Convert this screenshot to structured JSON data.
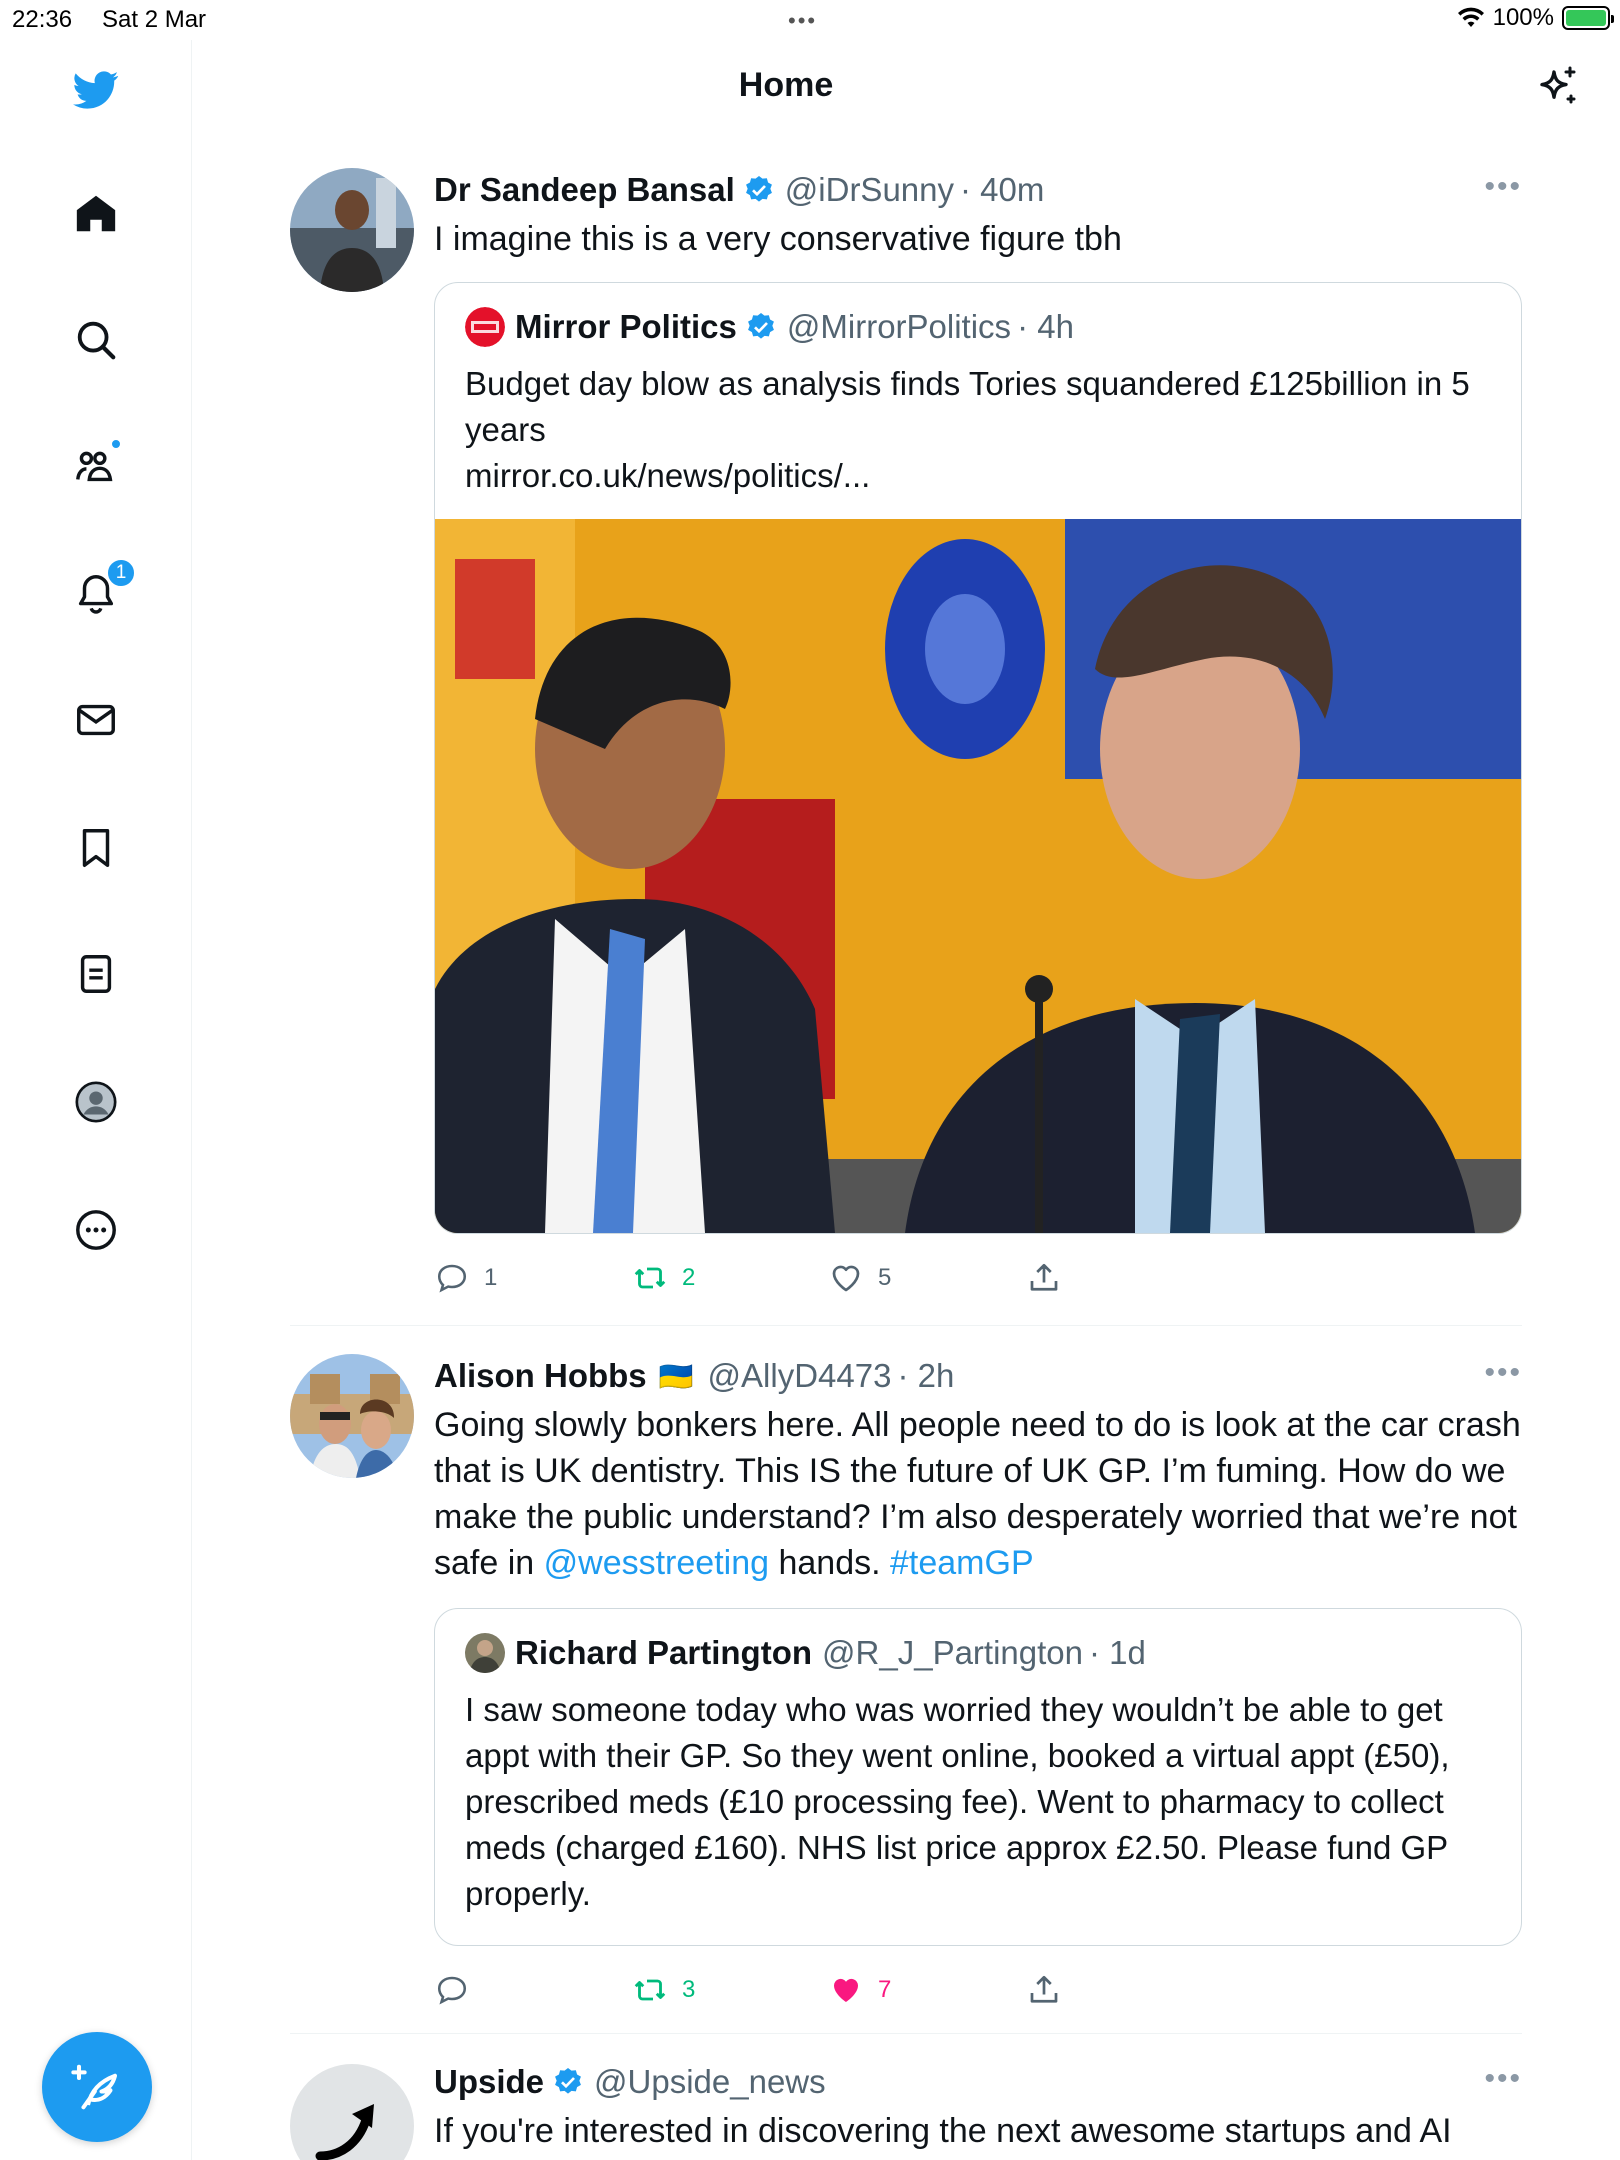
{
  "status_bar": {
    "time": "22:36",
    "date": "Sat 2 Mar",
    "dots": "•••",
    "battery_label": "100%"
  },
  "header": {
    "title": "Home"
  },
  "nav": {
    "notifications_badge": "1"
  },
  "tweets": [
    {
      "name": "Dr Sandeep Bansal",
      "handle": "@iDrSunny",
      "time": "· 40m",
      "text": "I imagine this is a very conservative figure tbh",
      "quote": {
        "name": "Mirror Politics",
        "handle": "@MirrorPolitics",
        "time": "· 4h",
        "text": "Budget day blow as analysis finds Tories squandered £125billion in 5 years",
        "url": "mirror.co.uk/news/politics/..."
      },
      "replies": "1",
      "retweets": "2",
      "likes": "5"
    },
    {
      "name": "Alison Hobbs",
      "flag": "🇺🇦",
      "handle": "@AllyD4473",
      "time": "· 2h",
      "text_part1": "Going slowly bonkers here. All people need to do is look at the car crash that is UK dentistry. This IS the future of UK GP. I’m fuming. How do we make the public understand? I’m also desperately worried that we’re not safe in ",
      "mention": "@wesstreeting",
      "text_part2": " hands. ",
      "hashtag": "#teamGP",
      "quote": {
        "name": "Richard Partington",
        "handle": "@R_J_Partington",
        "time": "· 1d",
        "text": "I saw someone today who was worried they wouldn’t be able to get appt with their GP. So they went online, booked a virtual appt (£50), prescribed meds (£10 processing fee). Went to pharmacy to collect meds (charged £160). NHS list price approx £2.50. Please fund GP properly."
      },
      "replies": "",
      "retweets": "3",
      "likes": "7"
    },
    {
      "name": "Upside",
      "handle": "@Upside_news",
      "text": "If you're interested in discovering the next awesome startups and AI"
    }
  ],
  "colors": {
    "accent": "#1d9bf0",
    "retweet": "#00ba7c",
    "like": "#f91880",
    "muted": "#536471"
  }
}
